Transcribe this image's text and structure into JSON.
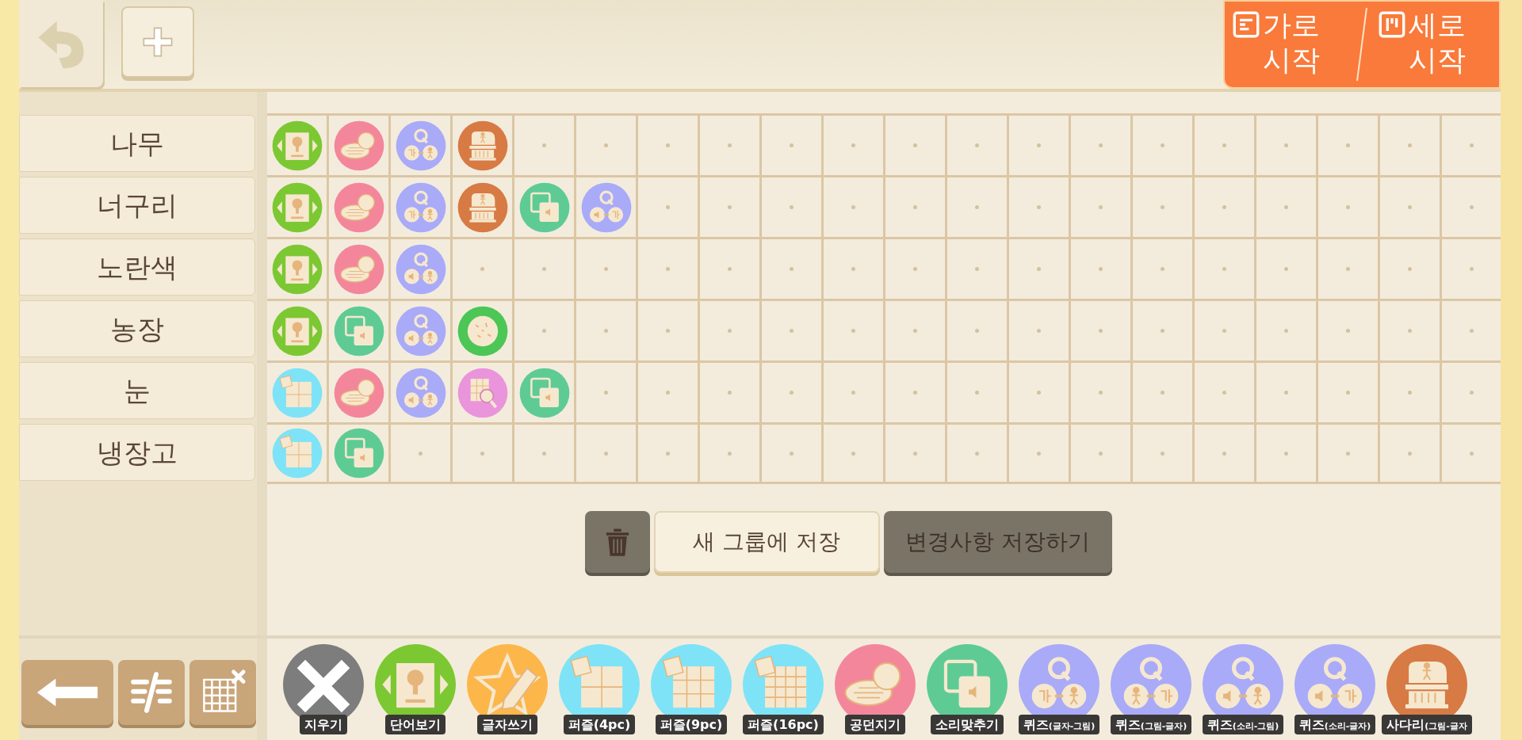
{
  "header": {
    "start_buttons": [
      {
        "kind": "horizontal",
        "line1": "가로",
        "line2": "시작"
      },
      {
        "kind": "vertical",
        "line1": "세로",
        "line2": "시작"
      }
    ]
  },
  "words": [
    {
      "label": "나무",
      "activities": [
        {
          "kind": "word_view"
        },
        {
          "kind": "ball_throw"
        },
        {
          "kind": "quiz_letter_picture"
        },
        {
          "kind": "ladder"
        }
      ]
    },
    {
      "label": "너구리",
      "activities": [
        {
          "kind": "word_view"
        },
        {
          "kind": "ball_throw"
        },
        {
          "kind": "quiz_letter_picture"
        },
        {
          "kind": "ladder"
        },
        {
          "kind": "sound_match"
        },
        {
          "kind": "quiz_sound_letter"
        }
      ]
    },
    {
      "label": "노란색",
      "activities": [
        {
          "kind": "word_view"
        },
        {
          "kind": "ball_throw"
        },
        {
          "kind": "quiz_sound_picture"
        }
      ]
    },
    {
      "label": "농장",
      "activities": [
        {
          "kind": "word_view"
        },
        {
          "kind": "sound_match"
        },
        {
          "kind": "quiz_sound_picture"
        },
        {
          "kind": "scatter"
        }
      ]
    },
    {
      "label": "눈",
      "activities": [
        {
          "kind": "puzzle4"
        },
        {
          "kind": "ball_throw"
        },
        {
          "kind": "quiz_sound_picture"
        },
        {
          "kind": "find"
        },
        {
          "kind": "sound_match"
        }
      ]
    },
    {
      "label": "냉장고",
      "activities": [
        {
          "kind": "puzzle4"
        },
        {
          "kind": "sound_match"
        }
      ]
    }
  ],
  "actions": {
    "new_group": "새 그룹에 저장",
    "save_changes": "변경사항 저장하기"
  },
  "tools": [
    {
      "kind": "erase",
      "label": "지우기"
    },
    {
      "kind": "word_view",
      "label": "단어보기"
    },
    {
      "kind": "write",
      "label": "글자쓰기"
    },
    {
      "kind": "puzzle4",
      "label": "퍼즐(4pc)"
    },
    {
      "kind": "puzzle9",
      "label": "퍼즐(9pc)"
    },
    {
      "kind": "puzzle16",
      "label": "퍼즐(16pc)"
    },
    {
      "kind": "ball_throw",
      "label": "공던지기"
    },
    {
      "kind": "sound_match",
      "label": "소리맞추기"
    },
    {
      "kind": "quiz_letter_picture",
      "label": "퀴즈",
      "sub": "(글자-그림)"
    },
    {
      "kind": "quiz_picture_letter",
      "label": "퀴즈",
      "sub": "(그림-글자)"
    },
    {
      "kind": "quiz_sound_picture",
      "label": "퀴즈",
      "sub": "(소리-그림)"
    },
    {
      "kind": "quiz_sound_letter",
      "label": "퀴즈",
      "sub": "(소리-글자)"
    },
    {
      "kind": "ladder",
      "label": "사다리",
      "sub": "(그림-글자"
    }
  ]
}
